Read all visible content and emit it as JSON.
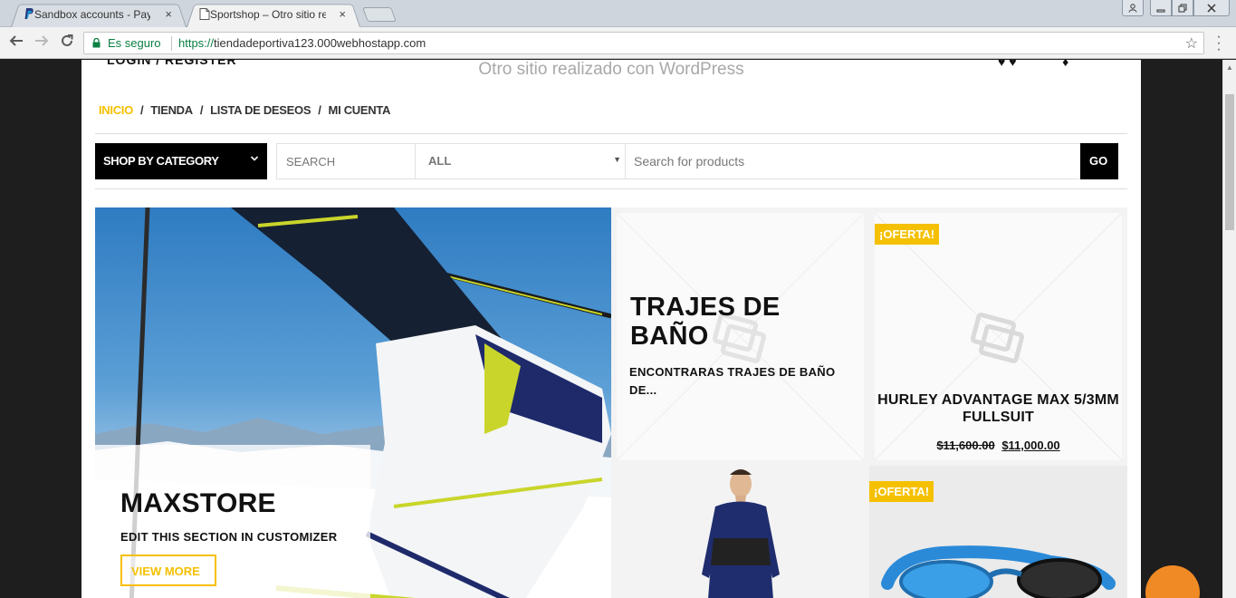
{
  "browser": {
    "tabs": [
      {
        "title": "Sandbox accounts - PayPal",
        "favicon": "paypal-icon",
        "active": false
      },
      {
        "title": "Sportshop – Otro sitio re",
        "favicon": "page-icon",
        "active": true
      }
    ],
    "close_glyph": "×",
    "address": {
      "secure_label": "Es seguro",
      "scheme": "https://",
      "host": "tiendadeportiva123.000webhostapp.com"
    }
  },
  "site": {
    "tagline": "Otro sitio realizado con WordPress",
    "cut_header_text": "LOGIN / REGISTER",
    "breadcrumb": [
      {
        "label": "INICIO",
        "active": true
      },
      {
        "label": "TIENDA",
        "active": false
      },
      {
        "label": "LISTA DE DESEOS",
        "active": false
      },
      {
        "label": "MI CUENTA",
        "active": false
      }
    ],
    "breadcrumb_sep": "/"
  },
  "searchbar": {
    "category_button": "SHOP BY CATEGORY",
    "search_label": "SEARCH",
    "category_select": "ALL",
    "placeholder": "Search for products",
    "go_label": "GO"
  },
  "hero": {
    "title": "MAXSTORE",
    "subtitle": "EDIT THIS SECTION IN CUSTOMIZER",
    "button": "VIEW MORE"
  },
  "tiles": {
    "category": {
      "title": "TRAJES DE BAÑO",
      "description": "ENCONTRARAS TRAJES DE BAÑO DE..."
    },
    "product1": {
      "badge": "¡OFERTA!",
      "name": "HURLEY ADVANTAGE MAX 5/3MM FULLSUIT",
      "old_price": "$11,600.00",
      "new_price": "$11,000.00"
    },
    "product2": {
      "badge": "¡OFERTA!"
    }
  },
  "colors": {
    "accent": "#f5c000",
    "secure_green": "#0b8043"
  }
}
